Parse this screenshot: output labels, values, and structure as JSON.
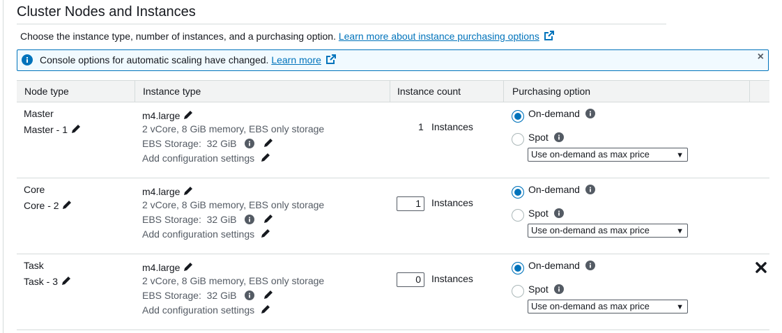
{
  "section": {
    "title": "Cluster Nodes and Instances",
    "intro_text": "Choose the instance type, number of instances, and a purchasing option.",
    "intro_link": "Learn more about instance purchasing options"
  },
  "banner": {
    "message": "Console options for automatic scaling have changed.",
    "link": "Learn more",
    "close": "×"
  },
  "table": {
    "headers": [
      "Node type",
      "Instance type",
      "Instance count",
      "Purchasing option"
    ],
    "rows": [
      {
        "node_type": "Master",
        "node_name": "Master - 1",
        "instance_type": "m4.large",
        "instance_desc": "2 vCore, 8 GiB memory, EBS only storage",
        "ebs_label": "EBS Storage:",
        "ebs_value": "32 GiB",
        "add_config": "Add configuration settings",
        "count": "1",
        "count_label": "Instances",
        "on_demand": "On-demand",
        "spot": "Spot",
        "select_value": "Use on-demand as max price"
      },
      {
        "node_type": "Core",
        "node_name": "Core - 2",
        "instance_type": "m4.large",
        "instance_desc": "2 vCore, 8 GiB memory, EBS only storage",
        "ebs_label": "EBS Storage:",
        "ebs_value": "32 GiB",
        "add_config": "Add configuration settings",
        "count": "1",
        "count_label": "Instances",
        "on_demand": "On-demand",
        "spot": "Spot",
        "select_value": "Use on-demand as max price"
      },
      {
        "node_type": "Task",
        "node_name": "Task - 3",
        "instance_type": "m4.large",
        "instance_desc": "2 vCore, 8 GiB memory, EBS only storage",
        "ebs_label": "EBS Storage:",
        "ebs_value": "32 GiB",
        "add_config": "Add configuration settings",
        "count": "0",
        "count_label": "Instances",
        "on_demand": "On-demand",
        "spot": "Spot",
        "select_value": "Use on-demand as max price"
      }
    ]
  },
  "colors": {
    "link": "#0073bb",
    "border": "#d5dbdb",
    "header_bg": "#f2f3f3",
    "banner_bg": "#f1faff"
  },
  "icons": [
    "info-icon",
    "external-link-icon",
    "pencil-icon",
    "close-icon",
    "remove-icon",
    "chevron-down-icon"
  ]
}
